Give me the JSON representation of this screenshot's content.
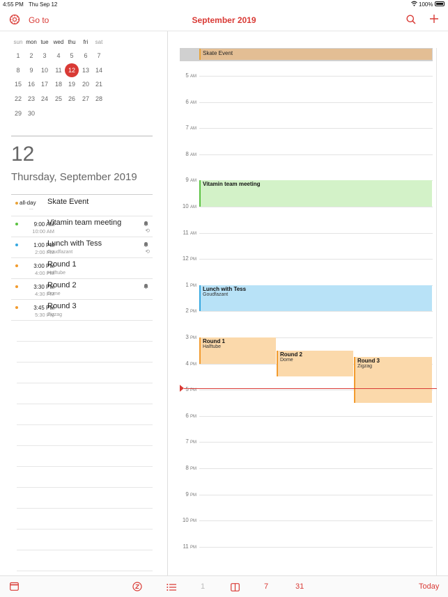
{
  "status": {
    "time": "4:55 PM",
    "date": "Thu Sep 12",
    "battery": "100%"
  },
  "header": {
    "goto_label": "Go to",
    "title": "September 2019"
  },
  "mini_calendar": {
    "weekdays": [
      "sun",
      "mon",
      "tue",
      "wed",
      "thu",
      "fri",
      "sat"
    ],
    "weeks": [
      [
        "1",
        "2",
        "3",
        "4",
        "5",
        "6",
        "7"
      ],
      [
        "8",
        "9",
        "10",
        "11",
        "12",
        "13",
        "14"
      ],
      [
        "15",
        "16",
        "17",
        "18",
        "19",
        "20",
        "21"
      ],
      [
        "22",
        "23",
        "24",
        "25",
        "26",
        "27",
        "28"
      ],
      [
        "29",
        "30",
        "",
        "",
        "",
        "",
        ""
      ]
    ],
    "selected": "12"
  },
  "day_detail": {
    "number": "12",
    "date_text": "Thursday, September 2019"
  },
  "agenda": [
    {
      "time_start": "all-day",
      "time_end": "...",
      "title": "Skate Event",
      "location": "",
      "color": "#e8a33a",
      "bell": false,
      "repeat": false
    },
    {
      "time_start": "9:00 AM",
      "time_end": "10:00 AM",
      "title": "Vitamin team meeting",
      "location": "",
      "color": "#5ac241",
      "bell": true,
      "repeat": true
    },
    {
      "time_start": "1:00 PM",
      "time_end": "2:00 PM",
      "title": "Lunch with Tess",
      "location": "Goudfazant",
      "color": "#35a8e0",
      "bell": true,
      "repeat": true
    },
    {
      "time_start": "3:00 PM",
      "time_end": "4:00 PM",
      "title": "Round 1",
      "location": "Halftube",
      "color": "#f29b2e",
      "bell": false,
      "repeat": false
    },
    {
      "time_start": "3:30 PM",
      "time_end": "4:30 PM",
      "title": "Round 2",
      "location": "Dome",
      "color": "#f29b2e",
      "bell": true,
      "repeat": false
    },
    {
      "time_start": "3:45 PM",
      "time_end": "5:30 PM",
      "title": "Round 3",
      "location": "Zigzag",
      "color": "#f29b2e",
      "bell": false,
      "repeat": false
    }
  ],
  "day_view": {
    "allday_event": "Skate Event",
    "hours": [
      {
        "num": "5",
        "ampm": "AM"
      },
      {
        "num": "6",
        "ampm": "AM"
      },
      {
        "num": "7",
        "ampm": "AM"
      },
      {
        "num": "8",
        "ampm": "AM"
      },
      {
        "num": "9",
        "ampm": "AM"
      },
      {
        "num": "10",
        "ampm": "AM"
      },
      {
        "num": "11",
        "ampm": "AM"
      },
      {
        "num": "12",
        "ampm": "PM"
      },
      {
        "num": "1",
        "ampm": "PM"
      },
      {
        "num": "2",
        "ampm": "PM"
      },
      {
        "num": "3",
        "ampm": "PM"
      },
      {
        "num": "4",
        "ampm": "PM"
      },
      {
        "num": "5",
        "ampm": "PM"
      },
      {
        "num": "6",
        "ampm": "PM"
      },
      {
        "num": "7",
        "ampm": "PM"
      },
      {
        "num": "8",
        "ampm": "PM"
      },
      {
        "num": "9",
        "ampm": "PM"
      },
      {
        "num": "10",
        "ampm": "PM"
      },
      {
        "num": "11",
        "ampm": "PM"
      }
    ],
    "events": [
      {
        "title": "Vitamin team meeting",
        "location": "",
        "fill": "#d3f2c8",
        "border": "#5ac241"
      },
      {
        "title": "Lunch with Tess",
        "location": "Goudfazant",
        "fill": "#b8e2f7",
        "border": "#35a8e0"
      },
      {
        "title": "Round 1",
        "location": "Halftube",
        "fill": "#fbd9ab",
        "border": "#f29b2e"
      },
      {
        "title": "Round 2",
        "location": "Dome",
        "fill": "#fbd9ab",
        "border": "#f29b2e"
      },
      {
        "title": "Round 3",
        "location": "Zigzag",
        "fill": "#fbd9ab",
        "border": "#f29b2e"
      }
    ]
  },
  "toolbar": {
    "view_1": "1",
    "view_7": "7",
    "view_31": "31",
    "today_label": "Today"
  },
  "colors": {
    "accent": "#d93a35"
  }
}
